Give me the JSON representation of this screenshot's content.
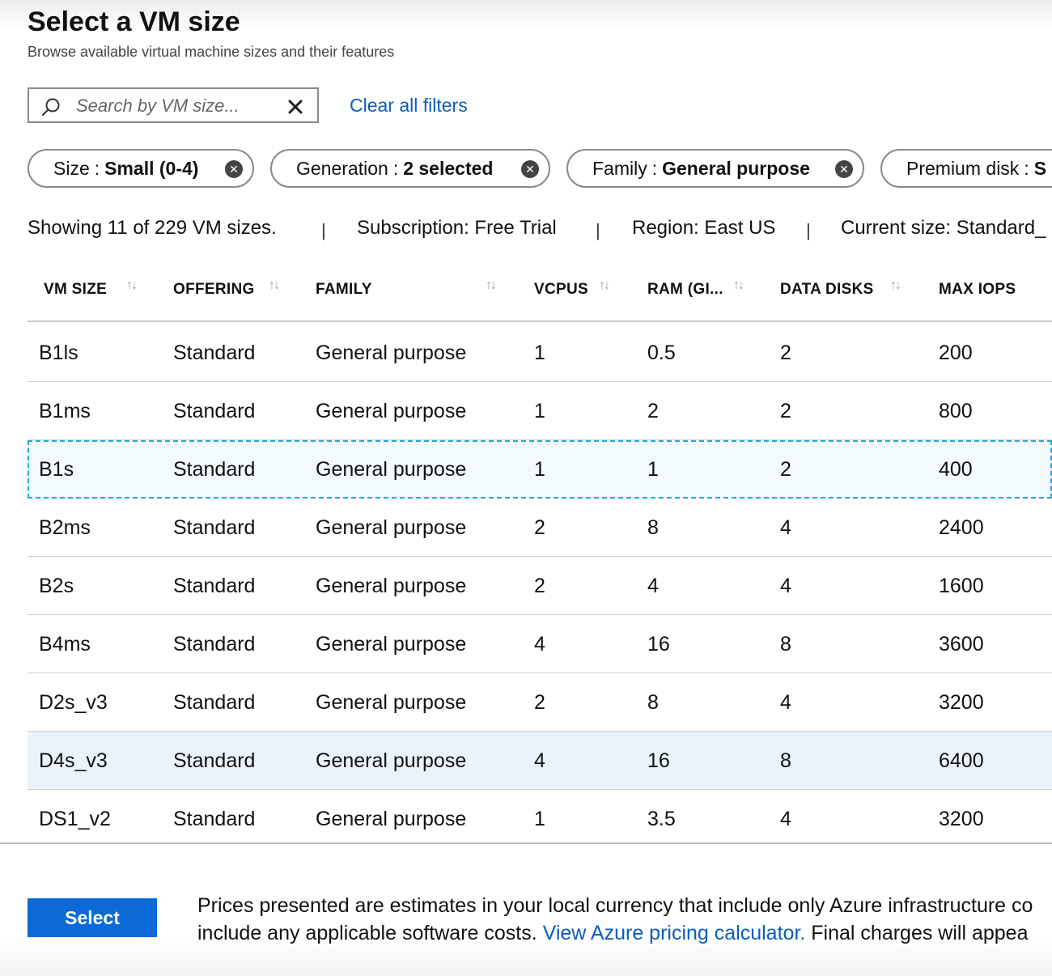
{
  "header": {
    "title": "Select a VM size",
    "subtitle": "Browse available virtual machine sizes and their features"
  },
  "search": {
    "placeholder": "Search by VM size...",
    "icon": "search-icon",
    "clear_icon": "close-icon"
  },
  "clear_filters_label": "Clear all filters",
  "filters": [
    {
      "label": "Size",
      "sep": ":",
      "value": "Small (0-4)"
    },
    {
      "label": "Generation",
      "sep": ":",
      "value": "2 selected"
    },
    {
      "label": "Family",
      "sep": ":",
      "value": "General purpose"
    },
    {
      "label": "Premium disk",
      "sep": ":",
      "value": "S"
    }
  ],
  "status": {
    "showing": "Showing 11 of 229 VM sizes.",
    "subscription": "Subscription: Free Trial",
    "region": "Region: East US",
    "current_size": "Current size: Standard_"
  },
  "table": {
    "columns": [
      "VM SIZE",
      "OFFERING",
      "FAMILY",
      "VCPUS",
      "RAM (GI...",
      "DATA DISKS",
      "MAX IOPS"
    ],
    "sort_glyph": "↑↓",
    "rows": [
      [
        "B1ls",
        "Standard",
        "General purpose",
        "1",
        "0.5",
        "2",
        "200"
      ],
      [
        "B1ms",
        "Standard",
        "General purpose",
        "1",
        "2",
        "2",
        "800"
      ],
      [
        "B1s",
        "Standard",
        "General purpose",
        "1",
        "1",
        "2",
        "400"
      ],
      [
        "B2ms",
        "Standard",
        "General purpose",
        "2",
        "8",
        "4",
        "2400"
      ],
      [
        "B2s",
        "Standard",
        "General purpose",
        "2",
        "4",
        "4",
        "1600"
      ],
      [
        "B4ms",
        "Standard",
        "General purpose",
        "4",
        "16",
        "8",
        "3600"
      ],
      [
        "D2s_v3",
        "Standard",
        "General purpose",
        "2",
        "8",
        "4",
        "3200"
      ],
      [
        "D4s_v3",
        "Standard",
        "General purpose",
        "4",
        "16",
        "8",
        "6400"
      ],
      [
        "DS1_v2",
        "Standard",
        "General purpose",
        "1",
        "3.5",
        "4",
        "3200"
      ]
    ],
    "focused_row": "B1s",
    "highlighted_row": "D4s_v3"
  },
  "footer": {
    "select_label": "Select",
    "note_line1": "Prices presented are estimates in your local currency that include only Azure infrastructure co",
    "note_line2_pre": "include any applicable software costs. ",
    "note_link": "View Azure pricing calculator.",
    "note_line2_post": " Final charges will appea"
  },
  "colors": {
    "accent": "#0b6ad8",
    "link": "#0b5cbe",
    "focus_border": "#29a3d6",
    "hover_row": "#eaf3fc"
  }
}
